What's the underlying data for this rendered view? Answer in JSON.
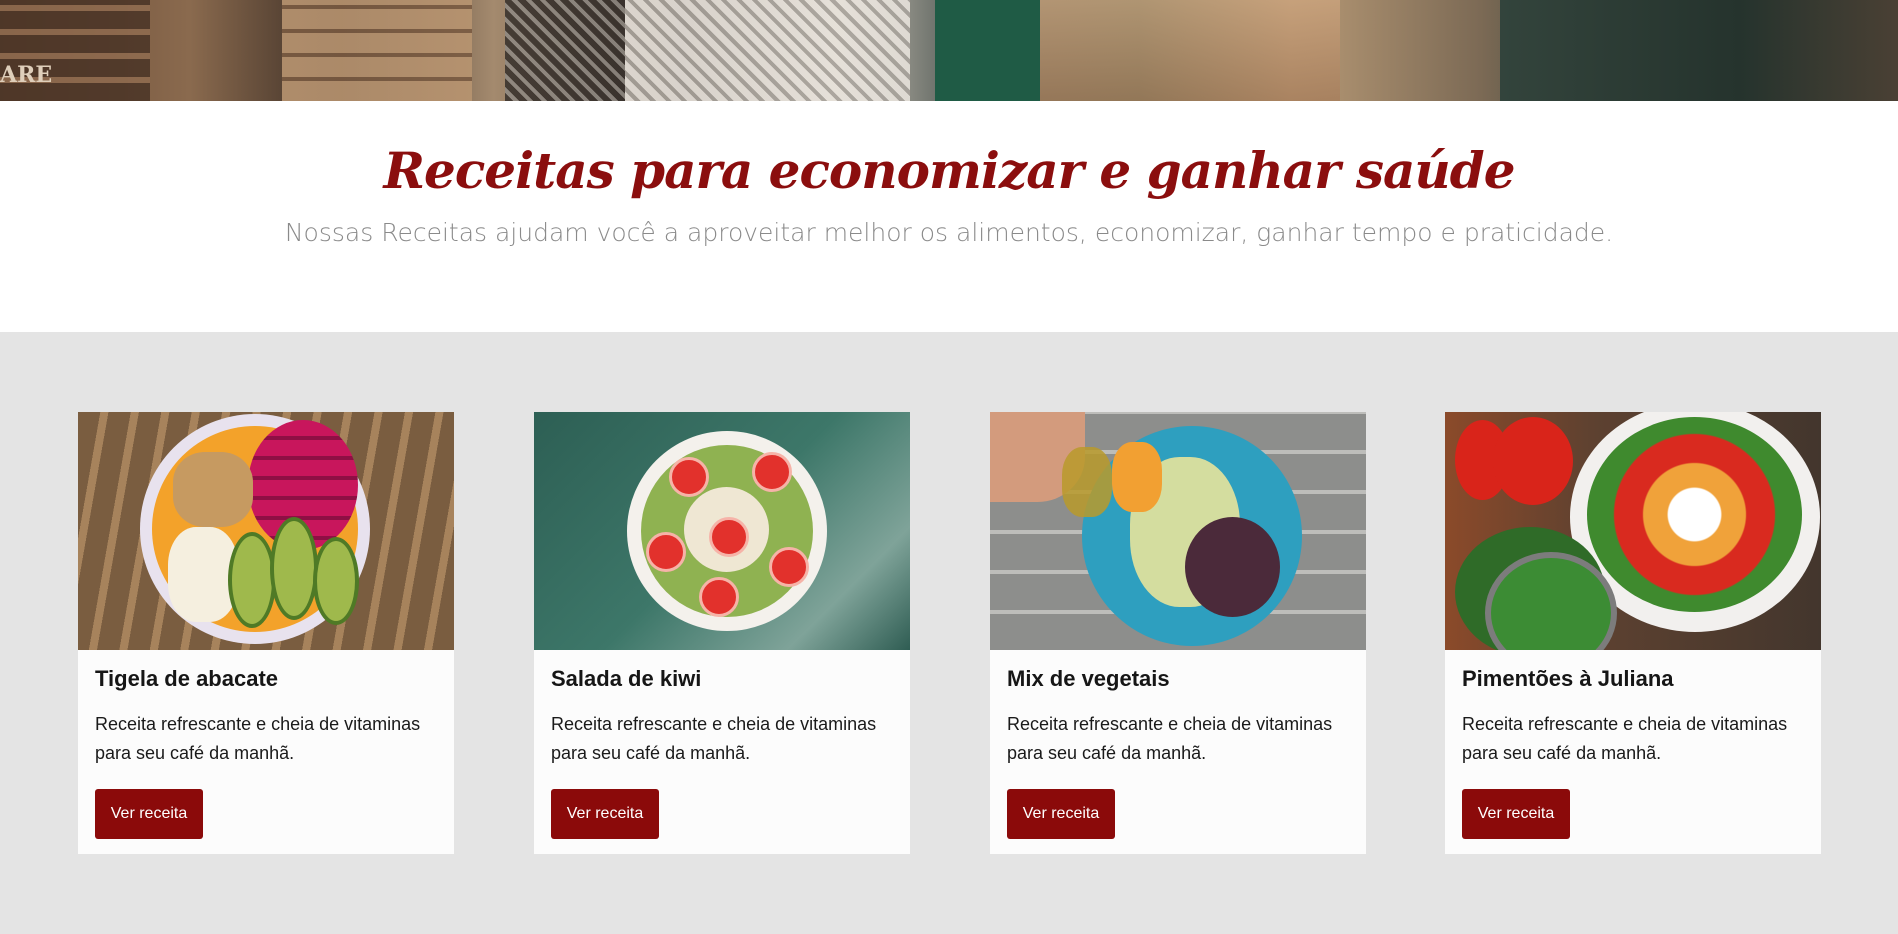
{
  "hero": {
    "banner_text": "ARE"
  },
  "intro": {
    "title": "Receitas para economizar e ganhar saúde",
    "subtitle": "Nossas Receitas ajudam você a aproveitar melhor os alimentos, economizar, ganhar tempo e praticidade."
  },
  "cards": [
    {
      "title": "Tigela de abacate",
      "description": "Receita refrescante e cheia de vitaminas para seu café da manhã.",
      "button_label": "Ver receita"
    },
    {
      "title": "Salada de kiwi",
      "description": "Receita refrescante e cheia de vitaminas para seu café da manhã.",
      "button_label": "Ver receita"
    },
    {
      "title": "Mix de vegetais",
      "description": "Receita refrescante e cheia de vitaminas para seu café da manhã.",
      "button_label": "Ver receita"
    },
    {
      "title": "Pimentões à Juliana",
      "description": "Receita refrescante e cheia de vitaminas para seu café da manhã.",
      "button_label": "Ver receita"
    }
  ],
  "colors": {
    "brand": "#8b0e0e",
    "button": "#8b0a0a",
    "section_bg": "#e4e4e4"
  }
}
